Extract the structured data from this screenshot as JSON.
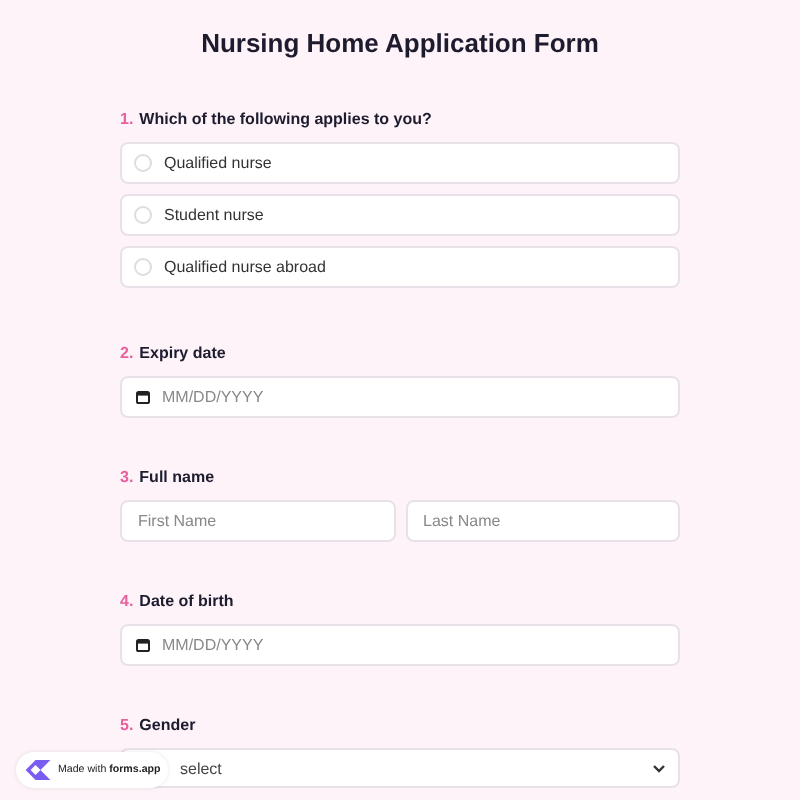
{
  "title": "Nursing Home Application Form",
  "questions": [
    {
      "number": "1.",
      "label": "Which of the following applies to you?",
      "kind": "radio",
      "options": [
        {
          "label": "Qualified nurse",
          "selected": false
        },
        {
          "label": "Student nurse",
          "selected": false
        },
        {
          "label": "Qualified nurse abroad",
          "selected": false
        }
      ]
    },
    {
      "number": "2.",
      "label": "Expiry date",
      "kind": "date",
      "placeholder": "MM/DD/YYYY"
    },
    {
      "number": "3.",
      "label": "Full name",
      "kind": "name",
      "placeholders": [
        "First Name",
        "Last Name"
      ]
    },
    {
      "number": "4.",
      "label": "Date of birth",
      "kind": "date",
      "placeholder": "MM/DD/YYYY"
    },
    {
      "number": "5.",
      "label": "Gender",
      "kind": "select",
      "value": "select"
    }
  ],
  "badge": {
    "prefix": "Made with",
    "brand": "forms.app"
  }
}
